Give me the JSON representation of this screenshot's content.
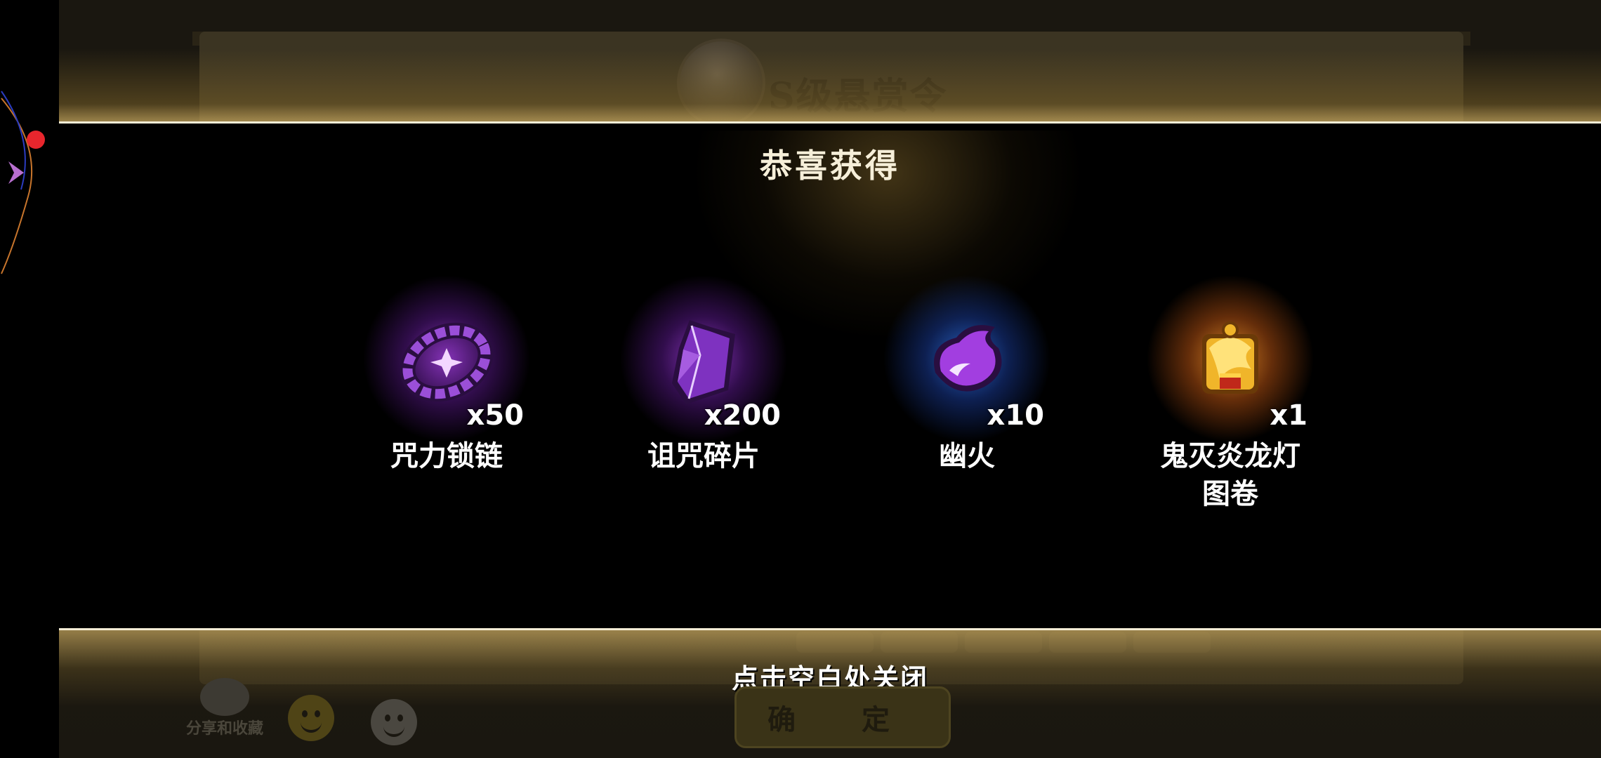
{
  "background": {
    "bounty_title": "S级悬赏令",
    "confirm_label": "确 定",
    "share_label": "分享和收藏"
  },
  "reward_panel": {
    "title": "恭喜获得",
    "items": [
      {
        "name": "咒力锁链",
        "quantity": "x50",
        "icon": "purple-chain-icon",
        "glow_color": "#9b3bd6"
      },
      {
        "name": "诅咒碎片",
        "quantity": "x200",
        "icon": "purple-crystal-shard-icon",
        "glow_color": "#9b3bd6"
      },
      {
        "name": "幽火",
        "quantity": "x10",
        "icon": "purple-ghost-fire-icon",
        "glow_color": "#2f6fe0"
      },
      {
        "name": "鬼灭炎龙灯\n图卷",
        "quantity": "x1",
        "icon": "golden-dragon-lantern-scroll-icon",
        "glow_color": "#e07a1e"
      }
    ],
    "close_hint": "点击空白处关闭"
  },
  "colors": {
    "accent_line": "#f4edd6",
    "purple_glow": "#9b3bd6",
    "blue_glow": "#2f6fe0",
    "orange_glow": "#e07a1e"
  }
}
